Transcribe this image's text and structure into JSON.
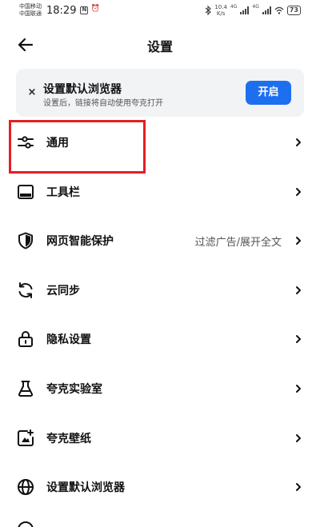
{
  "status_bar": {
    "carrier1": "中国移动",
    "carrier2": "中国联通",
    "time": "18:29",
    "nfc_icon": "N",
    "alarm_icon": "⏰",
    "network_speed_value": "10.4",
    "network_speed_unit": "K/s",
    "sim1_network": "4G",
    "sim2_network": "4G",
    "battery": "73"
  },
  "header": {
    "title": "设置"
  },
  "banner": {
    "close_symbol": "×",
    "title": "设置默认浏览器",
    "subtitle": "设置后，链接将自动使用夸克打开",
    "button_label": "开启"
  },
  "settings": {
    "items": [
      {
        "label": "通用",
        "value": "",
        "icon": "sliders-icon"
      },
      {
        "label": "工具栏",
        "value": "",
        "icon": "toolbar-icon"
      },
      {
        "label": "网页智能保护",
        "value": "过滤广告/展开全文",
        "icon": "shield-icon"
      },
      {
        "label": "云同步",
        "value": "",
        "icon": "sync-icon"
      },
      {
        "label": "隐私设置",
        "value": "",
        "icon": "lock-icon"
      },
      {
        "label": "夸克实验室",
        "value": "",
        "icon": "flask-icon"
      },
      {
        "label": "夸克壁纸",
        "value": "",
        "icon": "wallpaper-icon"
      },
      {
        "label": "设置默认浏览器",
        "value": "",
        "icon": "globe-icon"
      }
    ]
  },
  "colors": {
    "accent": "#1e6ff0",
    "highlight": "#e51e25",
    "banner_bg": "#f2f3f5"
  }
}
